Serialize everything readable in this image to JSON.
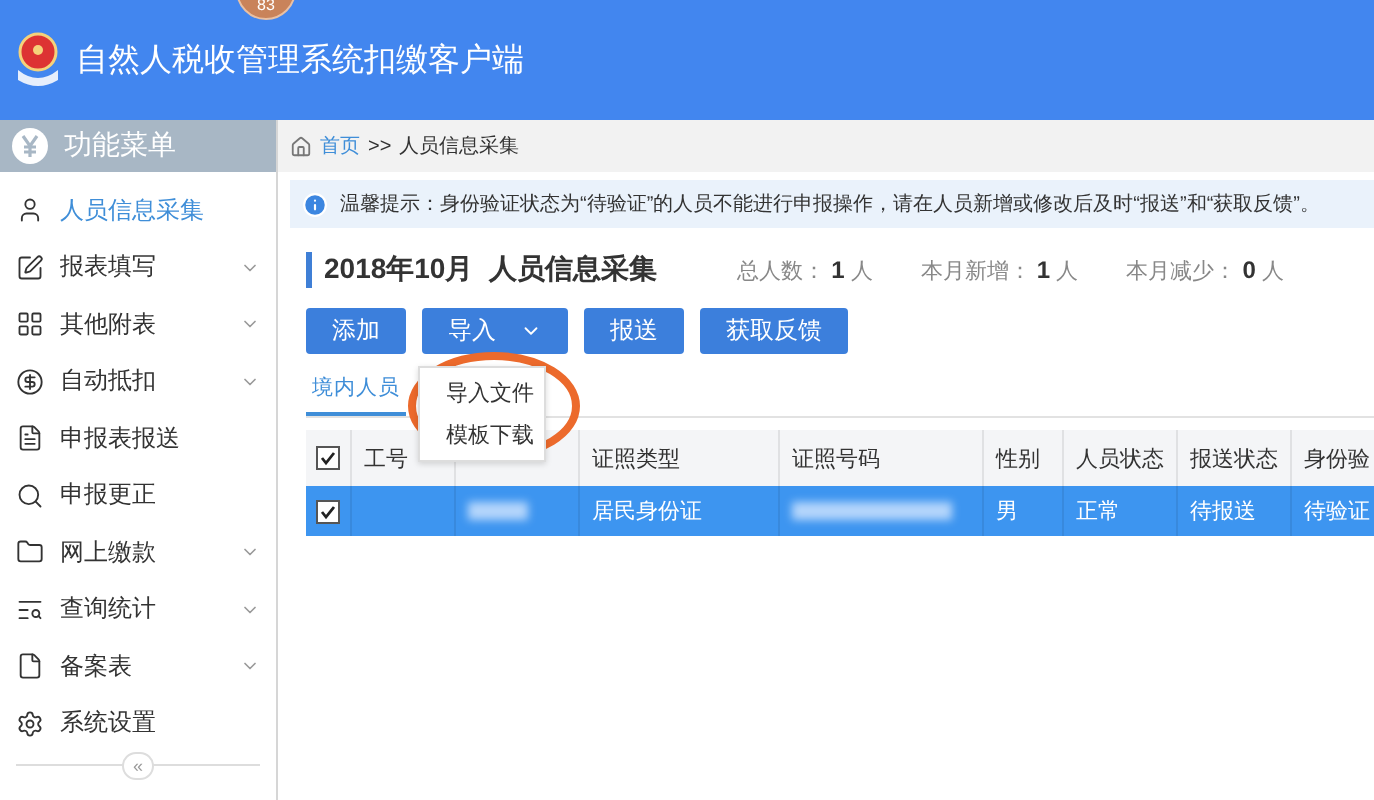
{
  "header": {
    "title": "自然人税收管理系统扣缴客户端",
    "badge": "83"
  },
  "sidebar": {
    "title": "功能菜单",
    "items": [
      {
        "label": "人员信息采集",
        "selected": true,
        "has_submenu": false
      },
      {
        "label": "报表填写",
        "selected": false,
        "has_submenu": true
      },
      {
        "label": "其他附表",
        "selected": false,
        "has_submenu": true
      },
      {
        "label": "自动抵扣",
        "selected": false,
        "has_submenu": true
      },
      {
        "label": "申报表报送",
        "selected": false,
        "has_submenu": false
      },
      {
        "label": "申报更正",
        "selected": false,
        "has_submenu": false
      },
      {
        "label": "网上缴款",
        "selected": false,
        "has_submenu": true
      },
      {
        "label": "查询统计",
        "selected": false,
        "has_submenu": true
      },
      {
        "label": "备案表",
        "selected": false,
        "has_submenu": true
      },
      {
        "label": "系统设置",
        "selected": false,
        "has_submenu": false
      }
    ],
    "collapse": "«"
  },
  "breadcrumb": {
    "home": "首页",
    "separator": ">>",
    "current": "人员信息采集"
  },
  "notice": "温馨提示：身份验证状态为“待验证”的人员不能进行申报操作，请在人员新增或修改后及时“报送”和“获取反馈”。",
  "title": "2018年10月  人员信息采集",
  "stats": [
    {
      "label": "总人数：",
      "value": "1",
      "unit": "人"
    },
    {
      "label": "本月新增：",
      "value": "1",
      "unit": "人"
    },
    {
      "label": "本月减少：",
      "value": "0",
      "unit": "人"
    }
  ],
  "buttons": [
    {
      "label": "添加",
      "kind": "plain"
    },
    {
      "label": "导入",
      "kind": "dropdown"
    },
    {
      "label": "报送",
      "kind": "plain"
    },
    {
      "label": "获取反馈",
      "kind": "plain"
    }
  ],
  "tabs": [
    {
      "label": "境内人员",
      "selected": true
    }
  ],
  "import_menu": [
    "导入文件",
    "模板下载"
  ],
  "table": {
    "all_checked": true,
    "columns": [
      "工号",
      "",
      "证照类型",
      "证照号码",
      "性别",
      "人员状态",
      "报送状态",
      "身份验"
    ],
    "rows": [
      {
        "checked": true,
        "selected": true,
        "cells": [
          {
            "kind": "text",
            "text": ""
          },
          {
            "kind": "redacted"
          },
          {
            "kind": "text",
            "text": "居民身份证"
          },
          {
            "kind": "redacted"
          },
          {
            "kind": "text",
            "text": "男"
          },
          {
            "kind": "text",
            "text": "正常"
          },
          {
            "kind": "text",
            "text": "待报送"
          },
          {
            "kind": "text",
            "text": "待验证"
          }
        ]
      }
    ]
  }
}
